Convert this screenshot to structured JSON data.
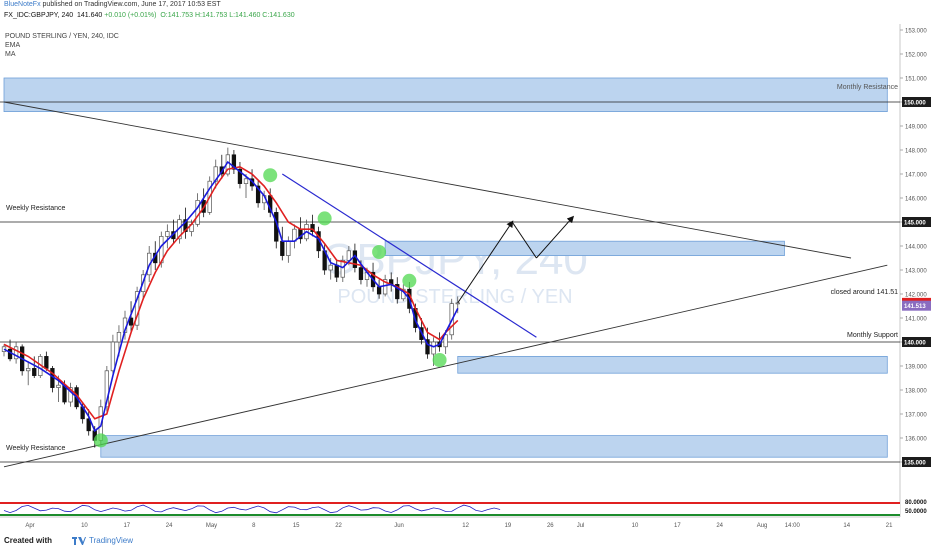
{
  "header": {
    "author": "BlueNoteFx",
    "published": "published on TradingView.com, June 17, 2017 10:53 EST",
    "symbol_line_prefix": "FX_IDC:GBPJPY, 240",
    "price": "141.640",
    "change": "+0.010 (+0.01%)",
    "ohlc": "O:141.753  H:141.753  L:141.460  C:141.630"
  },
  "legend": {
    "name": "POUND STERLING / YEN, 240, IDC",
    "ema": "EMA",
    "ma": "MA"
  },
  "watermark": {
    "symbol": "GBPJPY, 240",
    "name": "POUND STERLING / YEN"
  },
  "annotations": {
    "monthly_resistance": "Monthly Resistance",
    "weekly_resistance_top": "Weekly Resistance",
    "weekly_resistance_bottom": "Weekly Resistance",
    "monthly_support": "Monthly Support",
    "closed_around": "closed around 141.51"
  },
  "footer": {
    "created_with": "Created with",
    "brand": "TradingView"
  },
  "colors": {
    "ema": "#1a1adc",
    "ma": "#e02020",
    "zone": "#bcd4ef",
    "zone_border": "#6f9fd8",
    "marker": "#4fd84f",
    "trend": "#2a2ad0",
    "up": "#555555",
    "down": "#111111"
  },
  "chart_data": {
    "type": "candlestick",
    "symbol": "FX_IDC:GBPJPY",
    "interval": "240",
    "y_axis": {
      "ticks": [
        135,
        136,
        137,
        138,
        139,
        140,
        141,
        142,
        143,
        144,
        145,
        146,
        147,
        148,
        149,
        150,
        151,
        152,
        153
      ],
      "tick_labels": [
        "135.000",
        "136.000",
        "137.000",
        "138.000",
        "139.000",
        "140.000",
        "141.000",
        "142.000",
        "143.000",
        "144.000",
        "145.000",
        "146.000",
        "147.000",
        "148.000",
        "149.000",
        "150.000",
        "151.000",
        "152.000",
        "153.000"
      ],
      "highlighted_labels": [
        {
          "text": "150.000",
          "value": 150,
          "style": "dark"
        },
        {
          "text": "145.000",
          "value": 145,
          "style": "dark"
        },
        {
          "text": "141.630",
          "value": 141.63,
          "style": "red"
        },
        {
          "text": "141.513",
          "value": 141.513,
          "style": "purple"
        },
        {
          "text": "140.000",
          "value": 140,
          "style": "dark"
        },
        {
          "text": "135.000",
          "value": 135,
          "style": "dark"
        }
      ],
      "ylim": [
        134.6,
        153.2
      ]
    },
    "x_axis": {
      "tick_labels": [
        "Apr",
        "10",
        "17",
        "24",
        "May",
        "8",
        "15",
        "22",
        "Jun",
        "12",
        "19",
        "26",
        "Jul",
        "10",
        "17",
        "24",
        "Aug",
        "14:00",
        "14",
        "21"
      ],
      "day_index": [
        0,
        9,
        16,
        23,
        30,
        37,
        44,
        51,
        61,
        72,
        79,
        86,
        91,
        100,
        107,
        114,
        121,
        126,
        135,
        142
      ]
    },
    "zones": [
      {
        "label": "Monthly Resistance",
        "from_day": 0,
        "to_day": 146,
        "low": 149.6,
        "high": 151.0
      },
      {
        "label": "",
        "from_day": 63,
        "to_day": 129,
        "low": 143.6,
        "high": 144.2
      },
      {
        "label": "",
        "from_day": 75,
        "to_day": 146,
        "low": 138.7,
        "high": 139.4
      },
      {
        "label": "",
        "from_day": 16,
        "to_day": 146,
        "low": 135.2,
        "high": 136.1
      }
    ],
    "levels": [
      {
        "label": "Weekly Resistance",
        "value": 145.0
      },
      {
        "label": "Monthly Support",
        "value": 140.0
      },
      {
        "label": "Weekly Resistance",
        "value": 135.0
      },
      {
        "label": "",
        "value": 150.0
      }
    ],
    "trendlines": [
      {
        "name": "upper",
        "x1": 0,
        "y1": 150.0,
        "x2": 140,
        "y2": 143.5
      },
      {
        "name": "lower",
        "x1": 0,
        "y1": 134.8,
        "x2": 146,
        "y2": 143.2
      },
      {
        "name": "falling",
        "x1": 46,
        "y1": 147.0,
        "x2": 88,
        "y2": 140.2
      }
    ],
    "candles": [
      [
        0,
        139.6,
        139.9,
        139.4,
        139.8
      ],
      [
        1,
        139.7,
        140.1,
        139.2,
        139.3
      ],
      [
        2,
        139.3,
        140.0,
        139.1,
        139.8
      ],
      [
        3,
        139.8,
        139.9,
        138.6,
        138.8
      ],
      [
        4,
        138.8,
        139.2,
        138.2,
        138.9
      ],
      [
        5,
        138.9,
        139.4,
        138.5,
        138.6
      ],
      [
        6,
        138.6,
        139.5,
        138.5,
        139.4
      ],
      [
        7,
        139.4,
        139.6,
        138.8,
        138.9
      ],
      [
        8,
        138.9,
        139.0,
        137.9,
        138.1
      ],
      [
        9,
        138.1,
        138.6,
        137.5,
        138.2
      ],
      [
        10,
        138.2,
        138.4,
        137.4,
        137.5
      ],
      [
        11,
        137.5,
        138.3,
        137.3,
        138.1
      ],
      [
        12,
        138.1,
        138.2,
        137.2,
        137.3
      ],
      [
        13,
        137.3,
        137.5,
        136.6,
        136.8
      ],
      [
        14,
        136.8,
        137.2,
        136.1,
        136.3
      ],
      [
        15,
        136.3,
        136.5,
        135.6,
        135.9
      ],
      [
        16,
        135.9,
        137.6,
        135.7,
        137.3
      ],
      [
        17,
        137.3,
        139.0,
        137.1,
        138.8
      ],
      [
        18,
        138.8,
        140.3,
        138.6,
        140.0
      ],
      [
        19,
        140.0,
        140.7,
        139.4,
        140.4
      ],
      [
        20,
        140.4,
        141.3,
        140.1,
        141.0
      ],
      [
        21,
        141.0,
        141.7,
        140.4,
        140.7
      ],
      [
        22,
        140.7,
        142.3,
        140.5,
        142.1
      ],
      [
        23,
        142.1,
        143.0,
        141.8,
        142.8
      ],
      [
        24,
        142.8,
        144.0,
        142.5,
        143.7
      ],
      [
        25,
        143.7,
        144.2,
        143.0,
        143.3
      ],
      [
        26,
        143.3,
        144.6,
        143.1,
        144.4
      ],
      [
        27,
        144.4,
        144.9,
        143.9,
        144.6
      ],
      [
        28,
        144.6,
        145.1,
        144.1,
        144.3
      ],
      [
        29,
        144.3,
        145.3,
        144.1,
        145.1
      ],
      [
        30,
        145.1,
        145.6,
        144.3,
        144.6
      ],
      [
        31,
        144.6,
        145.1,
        144.4,
        144.9
      ],
      [
        32,
        144.9,
        146.2,
        144.8,
        145.9
      ],
      [
        33,
        145.9,
        146.4,
        145.2,
        145.4
      ],
      [
        34,
        145.4,
        146.9,
        145.3,
        146.7
      ],
      [
        35,
        146.7,
        147.6,
        146.4,
        147.3
      ],
      [
        36,
        147.3,
        147.8,
        146.8,
        147.0
      ],
      [
        37,
        147.0,
        148.1,
        146.9,
        147.8
      ],
      [
        38,
        147.8,
        148.0,
        147.0,
        147.2
      ],
      [
        39,
        147.2,
        147.5,
        146.4,
        146.6
      ],
      [
        40,
        146.6,
        147.0,
        146.0,
        146.8
      ],
      [
        41,
        146.8,
        147.2,
        146.3,
        146.5
      ],
      [
        42,
        146.5,
        146.7,
        145.6,
        145.8
      ],
      [
        43,
        145.8,
        146.3,
        145.5,
        146.1
      ],
      [
        44,
        146.1,
        146.4,
        145.2,
        145.4
      ],
      [
        45,
        145.4,
        145.6,
        143.9,
        144.2
      ],
      [
        46,
        144.2,
        144.8,
        143.4,
        143.6
      ],
      [
        47,
        143.6,
        144.4,
        143.3,
        144.2
      ],
      [
        48,
        144.2,
        144.9,
        143.9,
        144.7
      ],
      [
        49,
        144.7,
        145.2,
        144.1,
        144.3
      ],
      [
        50,
        144.3,
        145.1,
        144.2,
        144.9
      ],
      [
        51,
        144.9,
        145.3,
        144.4,
        144.6
      ],
      [
        52,
        144.6,
        144.8,
        143.5,
        143.8
      ],
      [
        53,
        143.8,
        144.1,
        142.8,
        143.0
      ],
      [
        54,
        143.0,
        143.5,
        142.6,
        143.2
      ],
      [
        55,
        143.2,
        143.4,
        142.5,
        142.7
      ],
      [
        56,
        142.7,
        143.6,
        142.5,
        143.4
      ],
      [
        57,
        143.4,
        144.0,
        143.2,
        143.8
      ],
      [
        58,
        143.8,
        144.1,
        142.9,
        143.1
      ],
      [
        59,
        143.1,
        143.4,
        142.4,
        142.6
      ],
      [
        60,
        142.6,
        143.1,
        142.3,
        142.9
      ],
      [
        61,
        142.9,
        143.3,
        142.1,
        142.3
      ],
      [
        62,
        142.3,
        142.6,
        141.8,
        142.0
      ],
      [
        63,
        142.0,
        142.8,
        141.9,
        142.6
      ],
      [
        64,
        142.6,
        142.9,
        142.1,
        142.4
      ],
      [
        65,
        142.4,
        142.7,
        141.6,
        141.8
      ],
      [
        66,
        141.8,
        142.4,
        141.7,
        142.2
      ],
      [
        67,
        142.2,
        142.5,
        141.2,
        141.4
      ],
      [
        68,
        141.4,
        141.6,
        140.4,
        140.6
      ],
      [
        69,
        140.6,
        141.0,
        139.9,
        140.1
      ],
      [
        70,
        140.1,
        140.6,
        139.3,
        139.5
      ],
      [
        71,
        139.5,
        140.2,
        139.0,
        140.0
      ],
      [
        72,
        140.0,
        140.4,
        139.6,
        139.8
      ],
      [
        73,
        139.8,
        140.5,
        139.5,
        140.3
      ],
      [
        74,
        140.3,
        141.8,
        140.1,
        141.6
      ],
      [
        75,
        141.6,
        141.9,
        141.2,
        141.63
      ]
    ],
    "ema": [
      [
        0,
        139.7
      ],
      [
        3,
        139.3
      ],
      [
        6,
        138.9
      ],
      [
        9,
        138.4
      ],
      [
        12,
        137.7
      ],
      [
        14,
        136.9
      ],
      [
        15,
        136.3
      ],
      [
        16,
        136.5
      ],
      [
        18,
        138.6
      ],
      [
        20,
        140.5
      ],
      [
        22,
        141.8
      ],
      [
        24,
        143.2
      ],
      [
        26,
        144.0
      ],
      [
        28,
        144.5
      ],
      [
        30,
        145.0
      ],
      [
        32,
        145.6
      ],
      [
        34,
        146.4
      ],
      [
        36,
        147.1
      ],
      [
        37,
        147.5
      ],
      [
        39,
        147.1
      ],
      [
        41,
        146.7
      ],
      [
        43,
        146.1
      ],
      [
        45,
        145.0
      ],
      [
        46,
        144.2
      ],
      [
        48,
        144.2
      ],
      [
        50,
        144.6
      ],
      [
        52,
        144.3
      ],
      [
        54,
        143.3
      ],
      [
        56,
        143.1
      ],
      [
        58,
        143.6
      ],
      [
        60,
        142.9
      ],
      [
        62,
        142.3
      ],
      [
        64,
        142.4
      ],
      [
        66,
        142.1
      ],
      [
        67,
        141.8
      ],
      [
        68,
        140.9
      ],
      [
        70,
        139.9
      ],
      [
        71,
        139.8
      ],
      [
        72,
        139.9
      ],
      [
        74,
        140.9
      ],
      [
        75,
        141.4
      ]
    ],
    "ma": [
      [
        0,
        139.9
      ],
      [
        4,
        139.4
      ],
      [
        8,
        138.7
      ],
      [
        12,
        137.8
      ],
      [
        15,
        136.8
      ],
      [
        17,
        137.0
      ],
      [
        19,
        138.8
      ],
      [
        21,
        140.4
      ],
      [
        23,
        141.8
      ],
      [
        25,
        142.9
      ],
      [
        27,
        143.8
      ],
      [
        29,
        144.4
      ],
      [
        31,
        144.9
      ],
      [
        33,
        145.6
      ],
      [
        35,
        146.5
      ],
      [
        37,
        147.2
      ],
      [
        39,
        147.3
      ],
      [
        41,
        147.0
      ],
      [
        43,
        146.5
      ],
      [
        45,
        145.8
      ],
      [
        47,
        145.0
      ],
      [
        49,
        144.7
      ],
      [
        51,
        144.7
      ],
      [
        53,
        144.1
      ],
      [
        55,
        143.4
      ],
      [
        57,
        143.3
      ],
      [
        59,
        143.2
      ],
      [
        61,
        142.8
      ],
      [
        63,
        142.5
      ],
      [
        65,
        142.3
      ],
      [
        67,
        142.0
      ],
      [
        68,
        141.4
      ],
      [
        70,
        140.4
      ],
      [
        72,
        140.1
      ],
      [
        73,
        140.4
      ],
      [
        75,
        140.9
      ]
    ],
    "markers": [
      [
        16,
        135.9
      ],
      [
        44,
        146.95
      ],
      [
        53,
        145.15
      ],
      [
        62,
        143.75
      ],
      [
        67,
        142.55
      ],
      [
        72,
        139.25
      ]
    ],
    "projection": [
      [
        75,
        141.63
      ],
      [
        84,
        145.0
      ],
      [
        88,
        143.5
      ],
      [
        94,
        145.2
      ]
    ],
    "oscillator": {
      "levels": [
        80,
        50,
        20
      ]
    }
  }
}
